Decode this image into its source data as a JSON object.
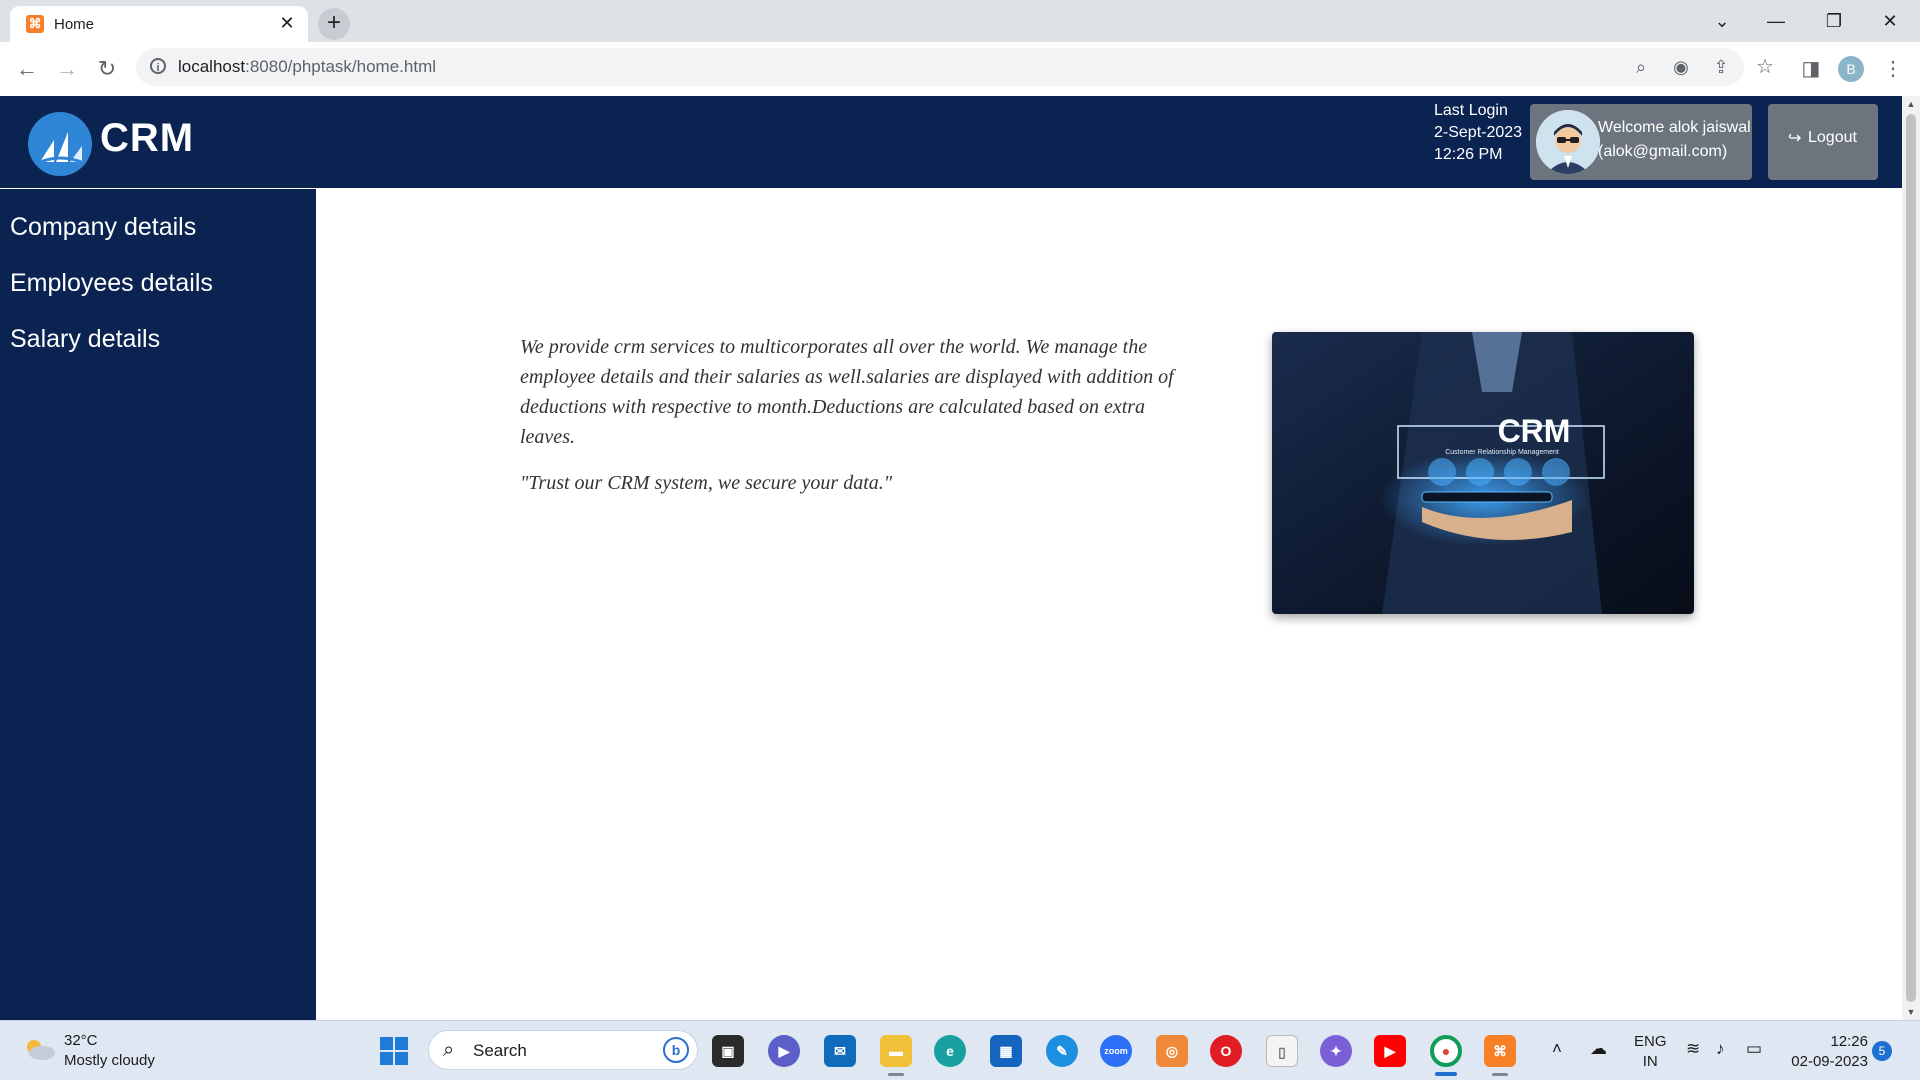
{
  "browser": {
    "tab_title": "Home",
    "tab_close": "✕",
    "new_tab": "+",
    "url_host": "localhost",
    "url_path": ":8080/phptask/home.html",
    "profile_initial": "B"
  },
  "header": {
    "logo_text": "CRM",
    "last_login_label": "Last Login",
    "last_login_date": "2-Sept-2023",
    "last_login_time": "12:26 PM",
    "welcome_line1": "Welcome alok jaiswal",
    "welcome_line2": "(alok@gmail.com)",
    "logout_label": "Logout"
  },
  "sidebar": {
    "items": [
      {
        "label": "Company details"
      },
      {
        "label": "Employees details"
      },
      {
        "label": "Salary details"
      }
    ]
  },
  "main": {
    "paragraph": "We provide crm services to multicorporates all over the world. We manage the employee details and their salaries as well.salaries are displayed with addition of deductions with respective to month.Deductions are calculated based on extra leaves.",
    "quote": "\"Trust our CRM system, we secure your data.\"",
    "hero_title": "CRM",
    "hero_subtitle": "Customer Relationship Management"
  },
  "taskbar": {
    "weather_temp": "32°C",
    "weather_desc": "Mostly cloudy",
    "search_label": "Search",
    "lang_line1": "ENG",
    "lang_line2": "IN",
    "time": "12:26",
    "date": "02-09-2023",
    "notification_count": "5"
  },
  "colors": {
    "brand_navy": "#0a2351",
    "header_button_gray": "#6c757d"
  }
}
